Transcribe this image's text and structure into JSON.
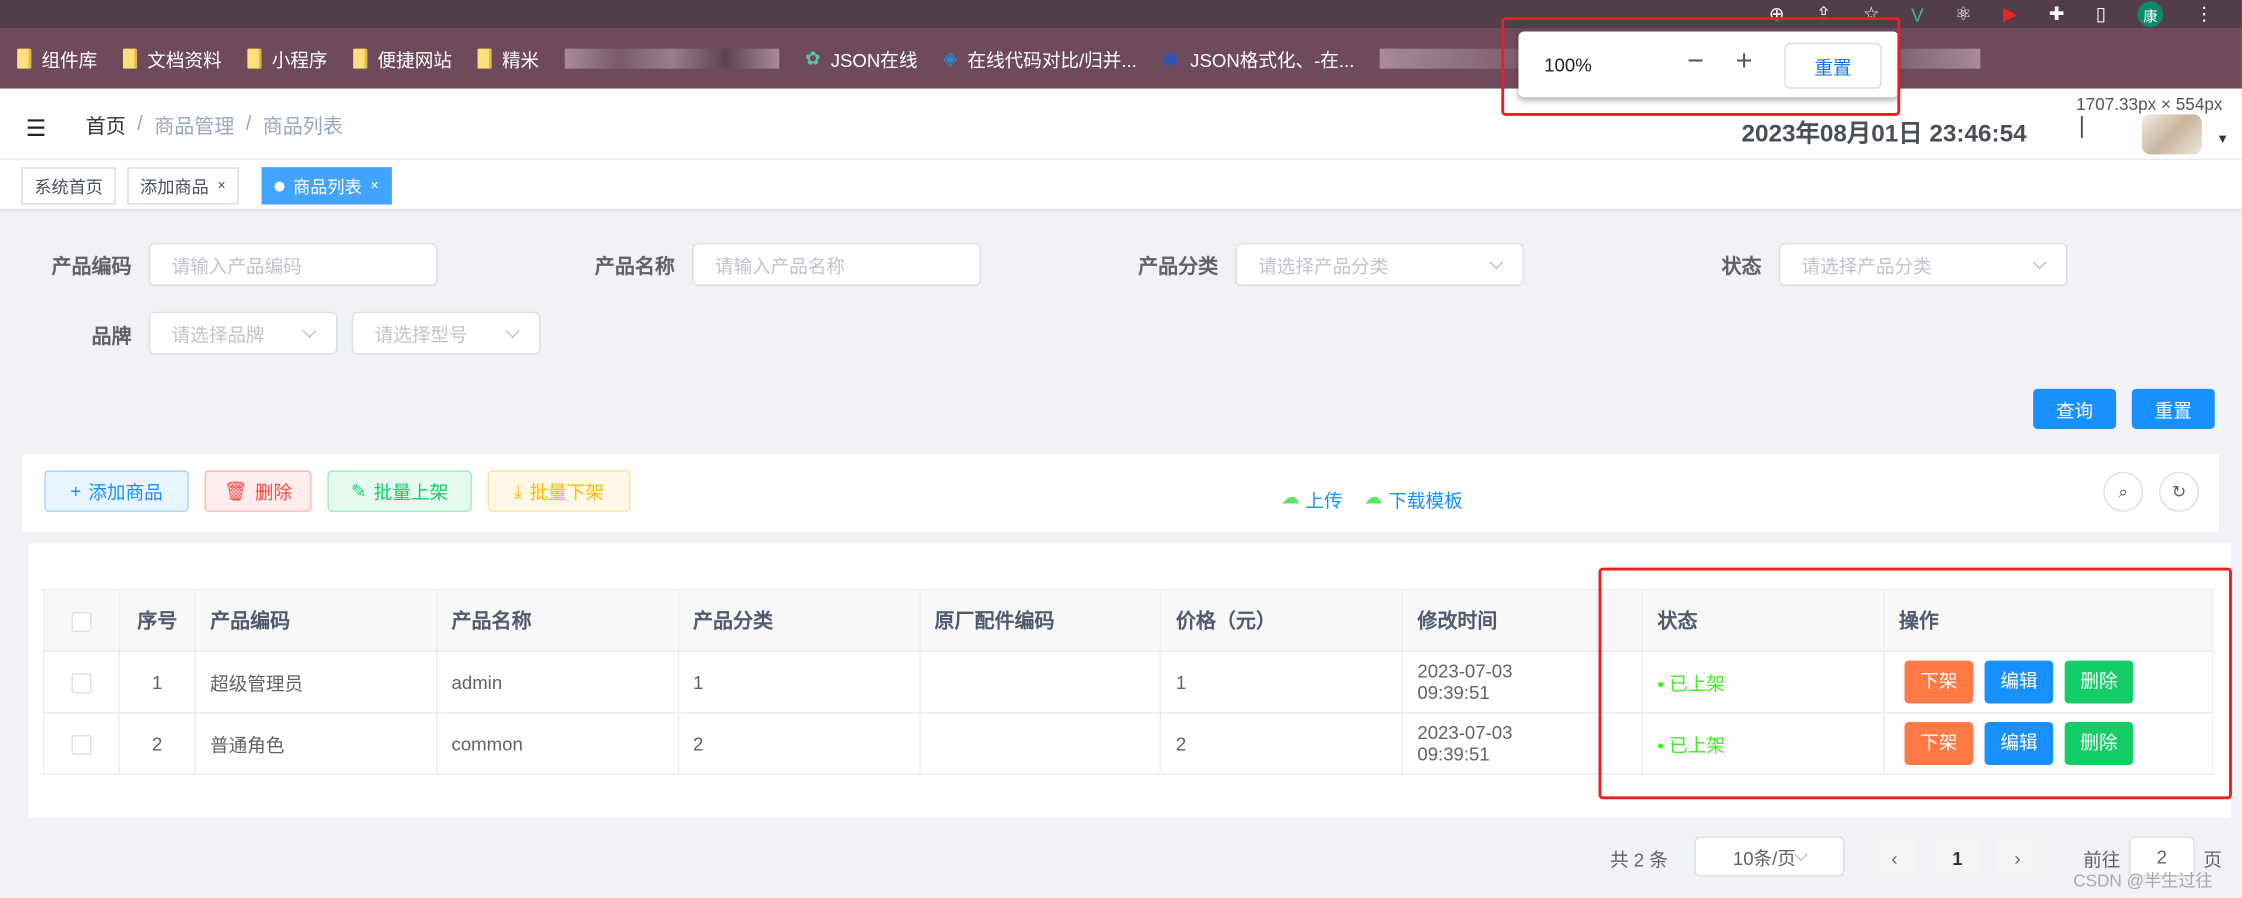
{
  "browser": {
    "bookmarks": [
      {
        "label": "组件库",
        "icon": "folder-icon"
      },
      {
        "label": "文档资料",
        "icon": "folder-icon"
      },
      {
        "label": "小程序",
        "icon": "folder-icon"
      },
      {
        "label": "便捷网站",
        "icon": "folder-icon"
      },
      {
        "label": "精米",
        "icon": "folder-icon"
      },
      {
        "label": "JSON在线",
        "icon": "gear-flower-icon"
      },
      {
        "label": "在线代码对比/归并...",
        "icon": "monkey-icon"
      },
      {
        "label": "JSON格式化、-在...",
        "icon": "briefcase-icon"
      }
    ],
    "profile_initial": "康",
    "zoom_popup": {
      "level": "100%",
      "minus": "−",
      "plus": "+",
      "reset": "重置"
    },
    "viewport_size": "1707.33px × 554px"
  },
  "header": {
    "breadcrumb": [
      "首页",
      "商品管理",
      "商品列表"
    ],
    "datetime": "2023年08月01日 23:46:54",
    "separator": "|"
  },
  "tags": [
    {
      "label": "系统首页"
    },
    {
      "label": "添加商品",
      "close": "×"
    },
    {
      "label": "商品列表",
      "close": "×",
      "active": true
    }
  ],
  "filters": {
    "code": {
      "label": "产品编码",
      "placeholder": "请输入产品编码"
    },
    "name": {
      "label": "产品名称",
      "placeholder": "请输入产品名称"
    },
    "category": {
      "label": "产品分类",
      "placeholder": "请选择产品分类"
    },
    "status": {
      "label": "状态",
      "placeholder": "请选择产品分类"
    },
    "brand": {
      "label": "品牌",
      "placeholder": "请选择品牌"
    },
    "model": {
      "placeholder": "请选择型号"
    },
    "query": "查询",
    "reset": "重置"
  },
  "toolbar": {
    "add": "添加商品",
    "delete": "删除",
    "batch_on": "批量上架",
    "batch_off": "批量下架",
    "upload": "上传",
    "download_template": "下载模板"
  },
  "table": {
    "columns": [
      "序号",
      "产品编码",
      "产品名称",
      "产品分类",
      "原厂配件编码",
      "价格（元）",
      "修改时间",
      "",
      "状态",
      "操作"
    ],
    "rows": [
      {
        "index": "1",
        "code": "超级管理员",
        "name": "admin",
        "category": "1",
        "oem": "",
        "price": "1",
        "modified": "2023-07-03 09:39:51",
        "status": "已上架"
      },
      {
        "index": "2",
        "code": "普通角色",
        "name": "common",
        "category": "2",
        "oem": "",
        "price": "2",
        "modified": "2023-07-03 09:39:51",
        "status": "已上架"
      }
    ],
    "actions": {
      "off": "下架",
      "edit": "编辑",
      "delete": "删除"
    }
  },
  "pagination": {
    "total": "共 2 条",
    "page_size": "10条/页",
    "current": "1",
    "goto_label": "前往",
    "goto_value": "2",
    "goto_suffix": "页"
  },
  "watermark": "CSDN @半生过往",
  "colors": {
    "primary": "#1890ff",
    "danger_off": "#ff7a45",
    "success": "#13ce66",
    "status_on": "#3cf01f",
    "annotation": "#f21c1c"
  }
}
